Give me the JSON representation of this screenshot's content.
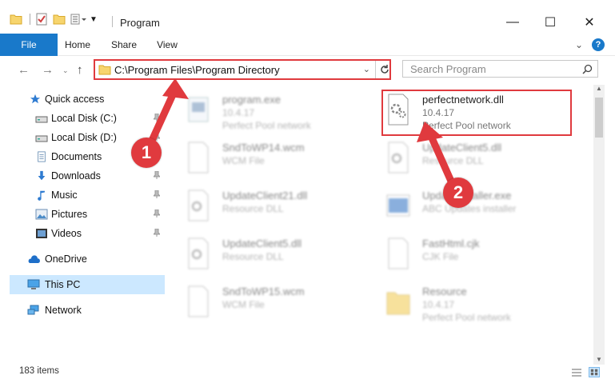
{
  "window": {
    "title": "Program",
    "minimize": "—",
    "maximize": "☐",
    "close": "✕"
  },
  "ribbon": {
    "tabs": [
      "File",
      "Home",
      "Share",
      "View"
    ],
    "expand": "⌄",
    "help": "?"
  },
  "address": {
    "path": "C:\\Program Files\\Program Directory",
    "search_placeholder": "Search Program"
  },
  "nav": {
    "items": [
      {
        "label": "Quick access",
        "icon": "star-icon"
      },
      {
        "label": "Local Disk (C:)",
        "icon": "drive-icon"
      },
      {
        "label": "Local Disk (D:)",
        "icon": "drive-icon"
      },
      {
        "label": "Documents",
        "icon": "documents-icon"
      },
      {
        "label": "Downloads",
        "icon": "downloads-icon"
      },
      {
        "label": "Music",
        "icon": "music-icon"
      },
      {
        "label": "Pictures",
        "icon": "pictures-icon"
      },
      {
        "label": "Videos",
        "icon": "videos-icon"
      },
      {
        "label": "OneDrive",
        "icon": "onedrive-icon"
      },
      {
        "label": "This PC",
        "icon": "this-pc-icon"
      },
      {
        "label": "Network",
        "icon": "network-icon"
      }
    ]
  },
  "files": [
    {
      "name": "program.exe",
      "line2": "10.4.17",
      "line3": "Perfect Pool network"
    },
    {
      "name": "perfectnetwork.dll",
      "line2": "10.4.17",
      "line3": "Perfect Pool network"
    },
    {
      "name": "SndToWP14.wcm",
      "line2": "WCM File",
      "line3": ""
    },
    {
      "name": "UpdateClient5.dll",
      "line2": "Resource DLL",
      "line3": ""
    },
    {
      "name": "UpdateClient21.dll",
      "line2": "Resource DLL",
      "line3": ""
    },
    {
      "name": "UpdateInstaller.exe",
      "line2": "ABC Updates installer",
      "line3": ""
    },
    {
      "name": "UpdateClient5.dll",
      "line2": "Resource DLL",
      "line3": ""
    },
    {
      "name": "FastHtml.cjk",
      "line2": "CJK File",
      "line3": ""
    },
    {
      "name": "SndToWP15.wcm",
      "line2": "WCM File",
      "line3": ""
    },
    {
      "name": "Resource",
      "line2": "10.4.17",
      "line3": "Perfect Pool network"
    }
  ],
  "status": {
    "items_count": "183 items"
  },
  "annotations": {
    "marker1": "1",
    "marker2": "2"
  },
  "colors": {
    "accent": "#1979ca",
    "highlight": "#e03a3e",
    "selected": "#cce8ff"
  }
}
